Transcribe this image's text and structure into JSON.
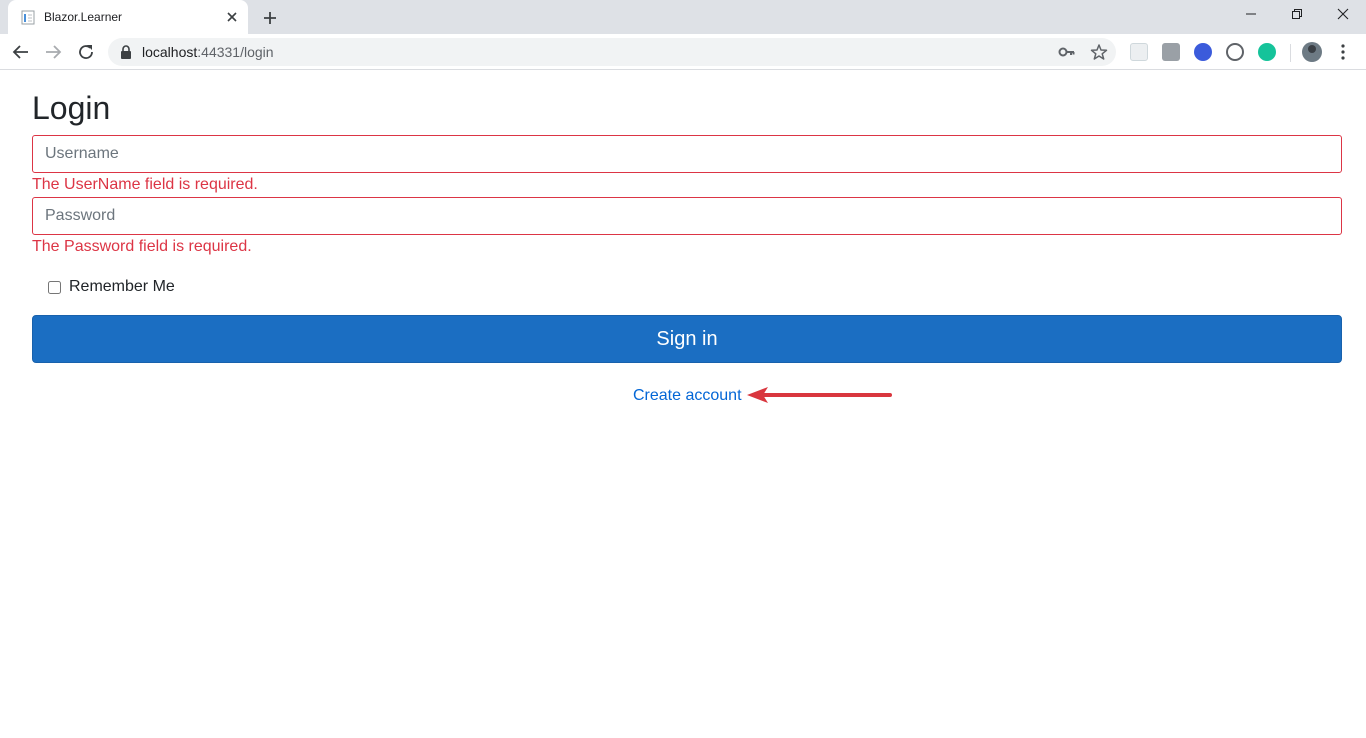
{
  "browser": {
    "tab_title": "Blazor.Learner",
    "url_host": "localhost",
    "url_rest": ":44331/login"
  },
  "page": {
    "title": "Login",
    "username": {
      "placeholder": "Username",
      "value": "",
      "error": "The UserName field is required."
    },
    "password": {
      "placeholder": "Password",
      "value": "",
      "error": "The Password field is required."
    },
    "remember_label": "Remember Me",
    "remember_checked": false,
    "signin_label": "Sign in",
    "create_account_label": "Create account"
  },
  "colors": {
    "primary": "#1b6ec2",
    "error": "#dc3545",
    "link": "#0366d6",
    "annotation_arrow": "#d9363e"
  },
  "icons": [
    "page-favicon-icon",
    "close-icon",
    "plus-icon",
    "minimize-icon",
    "restore-icon",
    "window-close-icon",
    "back-arrow-icon",
    "forward-arrow-icon",
    "reload-icon",
    "lock-icon",
    "key-icon",
    "star-icon",
    "extension-icon",
    "avatar",
    "more-vert-icon",
    "annotation-arrow"
  ]
}
